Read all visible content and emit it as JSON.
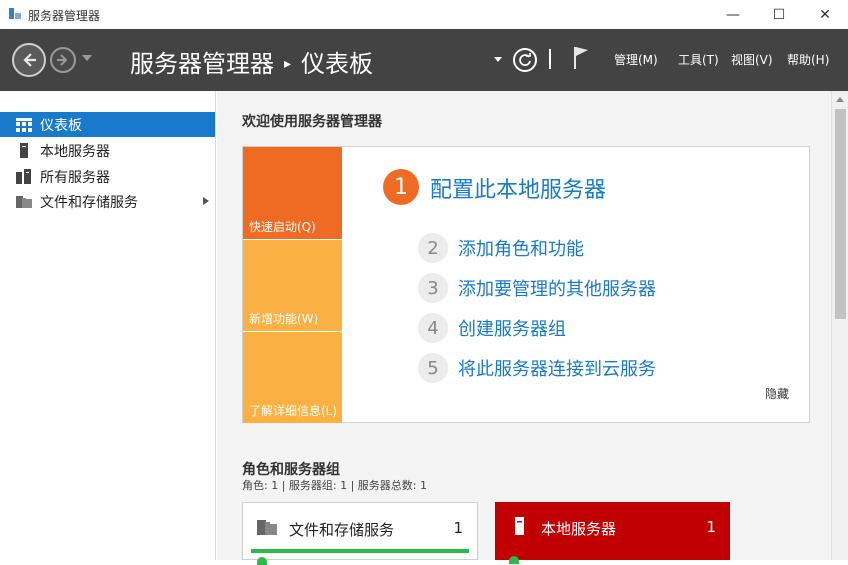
{
  "window": {
    "title": "服务器管理器",
    "minimize_glyph": "—",
    "maximize_glyph": "☐",
    "close_glyph": "✕"
  },
  "header": {
    "breadcrumb_root": "服务器管理器",
    "breadcrumb_separator": "▸",
    "breadcrumb_current": "仪表板",
    "menus": [
      {
        "label": "管理(M)"
      },
      {
        "label": "工具(T)"
      },
      {
        "label": "视图(V)"
      },
      {
        "label": "帮助(H)"
      }
    ]
  },
  "sidebar": {
    "items": [
      {
        "label": "仪表板",
        "icon": "dashboard-grid-icon",
        "active": true
      },
      {
        "label": "本地服务器",
        "icon": "server-icon"
      },
      {
        "label": "所有服务器",
        "icon": "servers-icon"
      },
      {
        "label": "文件和存储服务",
        "icon": "file-storage-icon",
        "expandable": true
      }
    ]
  },
  "welcome": {
    "title": "欢迎使用服务器管理器",
    "tiles": [
      {
        "label": "快速启动(Q)"
      },
      {
        "label": "新增功能(W)"
      },
      {
        "label": "了解详细信息(L)"
      }
    ],
    "primary_step": {
      "number": "1",
      "label": "配置此本地服务器"
    },
    "steps": [
      {
        "number": "2",
        "label": "添加角色和功能"
      },
      {
        "number": "3",
        "label": "添加要管理的其他服务器"
      },
      {
        "number": "4",
        "label": "创建服务器组"
      },
      {
        "number": "5",
        "label": "将此服务器连接到云服务"
      }
    ],
    "hide_label": "隐藏"
  },
  "roles": {
    "title": "角色和服务器组",
    "summary": "角色: 1 | 服务器组: 1 | 服务器总数: 1",
    "cards": [
      {
        "title": "文件和存储服务",
        "count": "1",
        "status_color": "#2db84b"
      },
      {
        "title": "本地服务器",
        "count": "1",
        "status_color": "#c00000"
      }
    ]
  },
  "colors": {
    "accent": "#1979ca",
    "header_bg": "#434343",
    "quick_start": "#ef6a23",
    "tile": "#fbb042",
    "alert": "#c00000",
    "ok": "#2db84b"
  }
}
